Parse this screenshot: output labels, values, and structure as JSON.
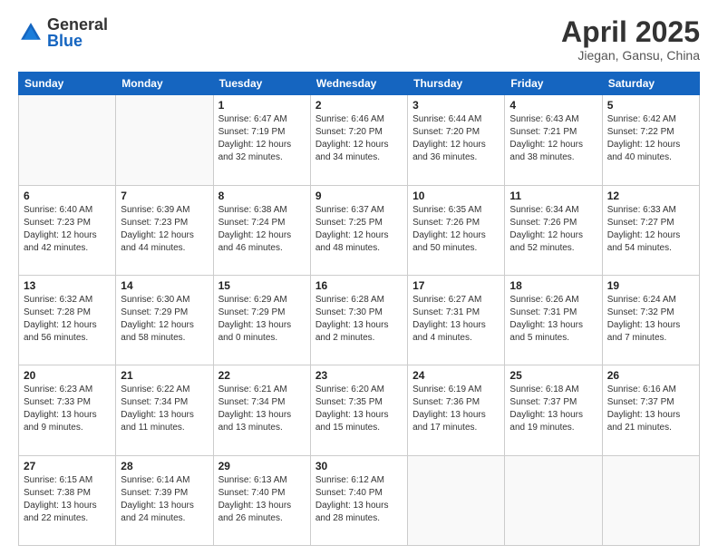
{
  "logo": {
    "general": "General",
    "blue": "Blue"
  },
  "header": {
    "title": "April 2025",
    "subtitle": "Jiegan, Gansu, China"
  },
  "weekdays": [
    "Sunday",
    "Monday",
    "Tuesday",
    "Wednesday",
    "Thursday",
    "Friday",
    "Saturday"
  ],
  "weeks": [
    [
      {
        "day": "",
        "info": ""
      },
      {
        "day": "",
        "info": ""
      },
      {
        "day": "1",
        "info": "Sunrise: 6:47 AM\nSunset: 7:19 PM\nDaylight: 12 hours\nand 32 minutes."
      },
      {
        "day": "2",
        "info": "Sunrise: 6:46 AM\nSunset: 7:20 PM\nDaylight: 12 hours\nand 34 minutes."
      },
      {
        "day": "3",
        "info": "Sunrise: 6:44 AM\nSunset: 7:20 PM\nDaylight: 12 hours\nand 36 minutes."
      },
      {
        "day": "4",
        "info": "Sunrise: 6:43 AM\nSunset: 7:21 PM\nDaylight: 12 hours\nand 38 minutes."
      },
      {
        "day": "5",
        "info": "Sunrise: 6:42 AM\nSunset: 7:22 PM\nDaylight: 12 hours\nand 40 minutes."
      }
    ],
    [
      {
        "day": "6",
        "info": "Sunrise: 6:40 AM\nSunset: 7:23 PM\nDaylight: 12 hours\nand 42 minutes."
      },
      {
        "day": "7",
        "info": "Sunrise: 6:39 AM\nSunset: 7:23 PM\nDaylight: 12 hours\nand 44 minutes."
      },
      {
        "day": "8",
        "info": "Sunrise: 6:38 AM\nSunset: 7:24 PM\nDaylight: 12 hours\nand 46 minutes."
      },
      {
        "day": "9",
        "info": "Sunrise: 6:37 AM\nSunset: 7:25 PM\nDaylight: 12 hours\nand 48 minutes."
      },
      {
        "day": "10",
        "info": "Sunrise: 6:35 AM\nSunset: 7:26 PM\nDaylight: 12 hours\nand 50 minutes."
      },
      {
        "day": "11",
        "info": "Sunrise: 6:34 AM\nSunset: 7:26 PM\nDaylight: 12 hours\nand 52 minutes."
      },
      {
        "day": "12",
        "info": "Sunrise: 6:33 AM\nSunset: 7:27 PM\nDaylight: 12 hours\nand 54 minutes."
      }
    ],
    [
      {
        "day": "13",
        "info": "Sunrise: 6:32 AM\nSunset: 7:28 PM\nDaylight: 12 hours\nand 56 minutes."
      },
      {
        "day": "14",
        "info": "Sunrise: 6:30 AM\nSunset: 7:29 PM\nDaylight: 12 hours\nand 58 minutes."
      },
      {
        "day": "15",
        "info": "Sunrise: 6:29 AM\nSunset: 7:29 PM\nDaylight: 13 hours\nand 0 minutes."
      },
      {
        "day": "16",
        "info": "Sunrise: 6:28 AM\nSunset: 7:30 PM\nDaylight: 13 hours\nand 2 minutes."
      },
      {
        "day": "17",
        "info": "Sunrise: 6:27 AM\nSunset: 7:31 PM\nDaylight: 13 hours\nand 4 minutes."
      },
      {
        "day": "18",
        "info": "Sunrise: 6:26 AM\nSunset: 7:31 PM\nDaylight: 13 hours\nand 5 minutes."
      },
      {
        "day": "19",
        "info": "Sunrise: 6:24 AM\nSunset: 7:32 PM\nDaylight: 13 hours\nand 7 minutes."
      }
    ],
    [
      {
        "day": "20",
        "info": "Sunrise: 6:23 AM\nSunset: 7:33 PM\nDaylight: 13 hours\nand 9 minutes."
      },
      {
        "day": "21",
        "info": "Sunrise: 6:22 AM\nSunset: 7:34 PM\nDaylight: 13 hours\nand 11 minutes."
      },
      {
        "day": "22",
        "info": "Sunrise: 6:21 AM\nSunset: 7:34 PM\nDaylight: 13 hours\nand 13 minutes."
      },
      {
        "day": "23",
        "info": "Sunrise: 6:20 AM\nSunset: 7:35 PM\nDaylight: 13 hours\nand 15 minutes."
      },
      {
        "day": "24",
        "info": "Sunrise: 6:19 AM\nSunset: 7:36 PM\nDaylight: 13 hours\nand 17 minutes."
      },
      {
        "day": "25",
        "info": "Sunrise: 6:18 AM\nSunset: 7:37 PM\nDaylight: 13 hours\nand 19 minutes."
      },
      {
        "day": "26",
        "info": "Sunrise: 6:16 AM\nSunset: 7:37 PM\nDaylight: 13 hours\nand 21 minutes."
      }
    ],
    [
      {
        "day": "27",
        "info": "Sunrise: 6:15 AM\nSunset: 7:38 PM\nDaylight: 13 hours\nand 22 minutes."
      },
      {
        "day": "28",
        "info": "Sunrise: 6:14 AM\nSunset: 7:39 PM\nDaylight: 13 hours\nand 24 minutes."
      },
      {
        "day": "29",
        "info": "Sunrise: 6:13 AM\nSunset: 7:40 PM\nDaylight: 13 hours\nand 26 minutes."
      },
      {
        "day": "30",
        "info": "Sunrise: 6:12 AM\nSunset: 7:40 PM\nDaylight: 13 hours\nand 28 minutes."
      },
      {
        "day": "",
        "info": ""
      },
      {
        "day": "",
        "info": ""
      },
      {
        "day": "",
        "info": ""
      }
    ]
  ]
}
